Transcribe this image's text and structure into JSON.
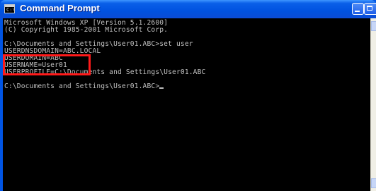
{
  "window": {
    "title": "Command Prompt",
    "icon_text": "C:\\",
    "icon": "cmd-icon"
  },
  "console": {
    "lines": [
      "Microsoft Windows XP [Version 5.1.2600]",
      "(C) Copyright 1985-2001 Microsoft Corp.",
      "",
      "C:\\Documents and Settings\\User01.ABC>set user",
      "USERDNSDOMAIN=ABC.LOCAL",
      "USERDOMAIN=ABC",
      "USERNAME=User01",
      "USERPROFILE=C:\\Documents and Settings\\User01.ABC",
      "",
      "C:\\Documents and Settings\\User01.ABC>"
    ]
  },
  "colors": {
    "console_background": "#000000",
    "console_text": "#c0c0c0",
    "titlebar": "#0054e3",
    "highlight": "#ff1a1a"
  }
}
